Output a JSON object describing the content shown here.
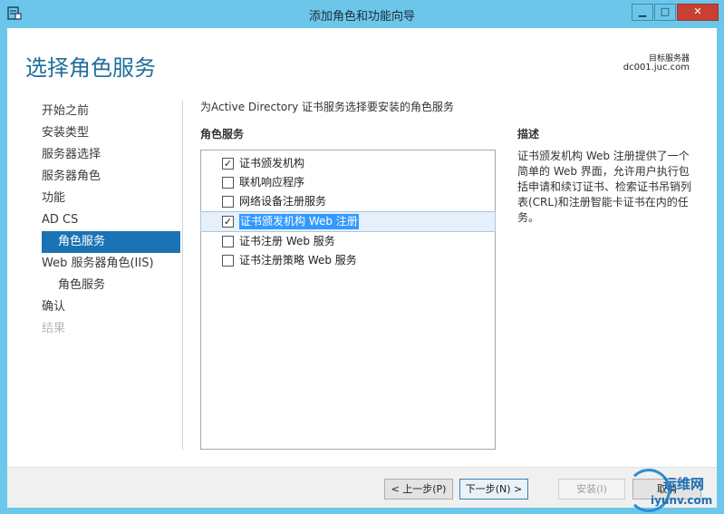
{
  "window": {
    "title": "添加角色和功能向导",
    "min_glyph": "▁",
    "max_glyph": "□",
    "close_glyph": "✕"
  },
  "header": {
    "page_title": "选择角色服务",
    "target_label": "目标服务器",
    "target_name": "dc001.juc.com"
  },
  "nav": {
    "items": [
      {
        "label": "开始之前",
        "state": "normal"
      },
      {
        "label": "安装类型",
        "state": "normal"
      },
      {
        "label": "服务器选择",
        "state": "normal"
      },
      {
        "label": "服务器角色",
        "state": "normal"
      },
      {
        "label": "功能",
        "state": "normal"
      },
      {
        "label": "AD CS",
        "state": "normal"
      },
      {
        "label": "角色服务",
        "state": "active"
      },
      {
        "label": "Web 服务器角色(IIS)",
        "state": "normal"
      },
      {
        "label": "角色服务",
        "state": "sub"
      },
      {
        "label": "确认",
        "state": "normal"
      },
      {
        "label": "结果",
        "state": "disabled"
      }
    ]
  },
  "main": {
    "instruction": "为Active Directory 证书服务选择要安装的角色服务",
    "roles_header": "角色服务",
    "roles": [
      {
        "label": "证书颁发机构",
        "checked": true
      },
      {
        "label": "联机响应程序",
        "checked": false
      },
      {
        "label": "网络设备注册服务",
        "checked": false
      },
      {
        "label": "证书颁发机构 Web 注册",
        "checked": true,
        "selected": true
      },
      {
        "label": "证书注册 Web 服务",
        "checked": false
      },
      {
        "label": "证书注册策略 Web 服务",
        "checked": false
      }
    ],
    "desc_header": "描述",
    "desc_text": "证书颁发机构 Web 注册提供了一个简单的 Web 界面，允许用户执行包括申请和续订证书、检索证书吊销列表(CRL)和注册智能卡证书在内的任务。"
  },
  "footer": {
    "prev_label": "< 上一步(P)",
    "next_label": "下一步(N) >",
    "install_label": "安装(I)",
    "cancel_label": "取消"
  },
  "watermark": {
    "top": "运维网",
    "bottom": "iyunv.com"
  },
  "colors": {
    "titlebar": "#6cc6ea",
    "accent": "#1a73b4",
    "page_title": "#1d6f9b",
    "close_button": "#c84031"
  }
}
